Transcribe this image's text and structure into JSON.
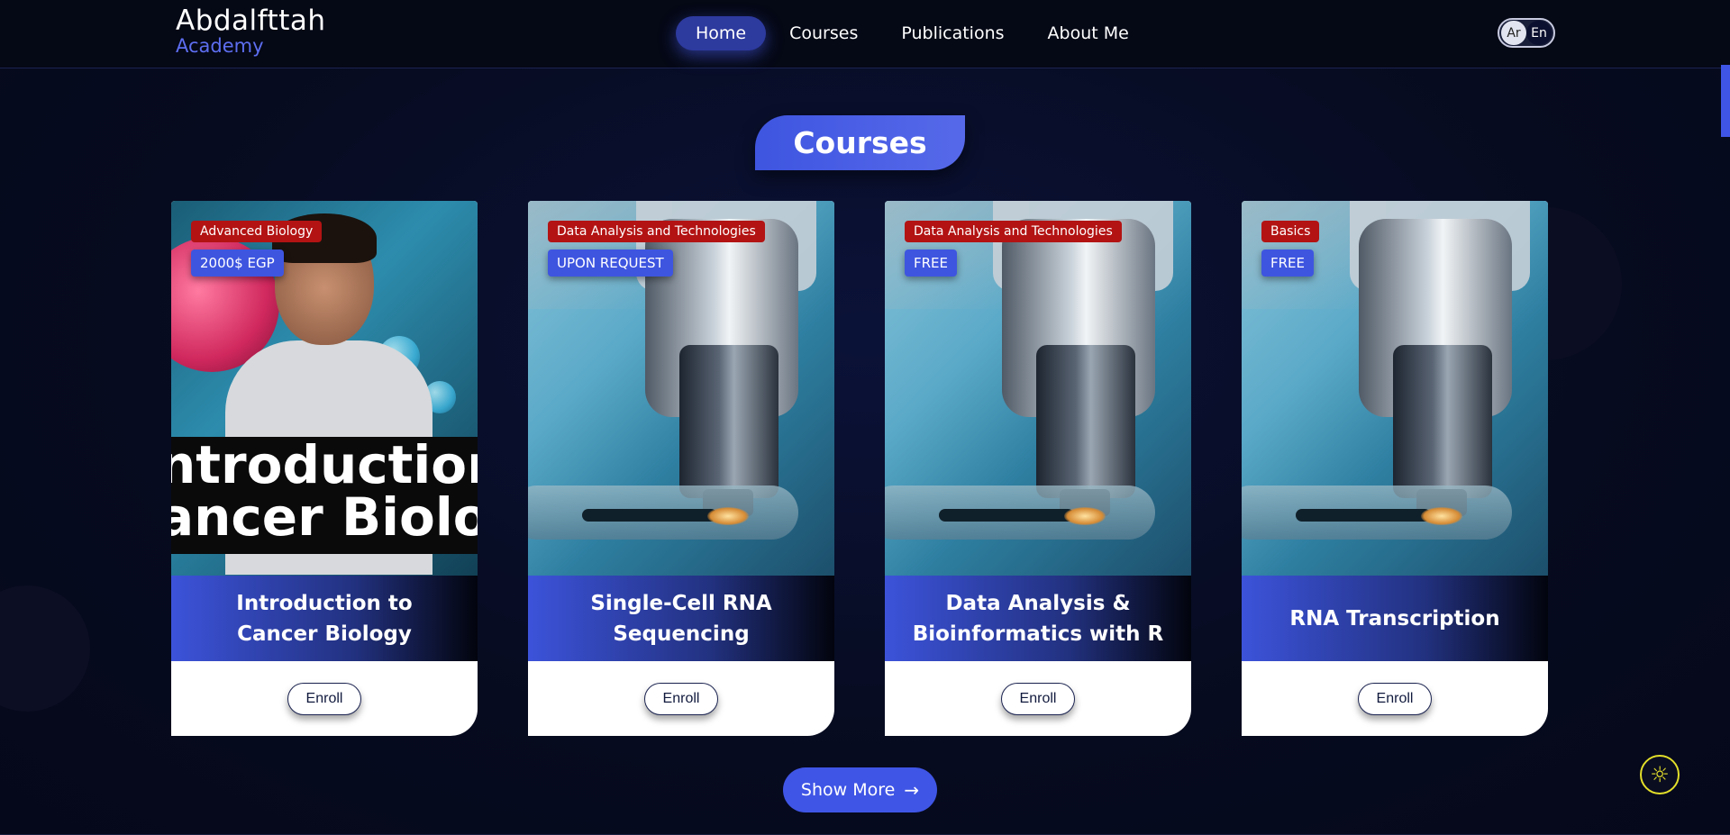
{
  "header": {
    "logo_name": "Abdalfttah",
    "logo_sub": "Academy",
    "nav": [
      {
        "label": "Home",
        "active": true
      },
      {
        "label": "Courses",
        "active": false
      },
      {
        "label": "Publications",
        "active": false
      },
      {
        "label": "About Me",
        "active": false
      }
    ],
    "lang": {
      "ar": "Ar",
      "en": "En",
      "selected": "En"
    }
  },
  "section_title": "Courses",
  "cards": [
    {
      "category": "Advanced Biology",
      "price": "2000$ EGP",
      "title": "Introduction to Cancer Biology",
      "image_text_1": "ntroduction T",
      "image_text_2": "ancer Biolog",
      "enroll_label": "Enroll"
    },
    {
      "category": "Data Analysis and Technologies",
      "price": "UPON REQUEST",
      "title": "Single-Cell RNA Sequencing",
      "enroll_label": "Enroll"
    },
    {
      "category": "Data Analysis and Technologies",
      "price": "FREE",
      "title": "Data Analysis & Bioinformatics with R",
      "enroll_label": "Enroll"
    },
    {
      "category": "Basics",
      "price": "FREE",
      "title": "RNA Transcription",
      "enroll_label": "Enroll"
    }
  ],
  "show_more": {
    "label": "Show More",
    "icon": "arrow-right-icon"
  },
  "theme_toggle": {
    "icon": "sun-icon"
  },
  "colors": {
    "accent": "#3f55e6",
    "category_tag": "#b31313",
    "header_bg": "#050815",
    "page_bg": "#070b1f"
  }
}
